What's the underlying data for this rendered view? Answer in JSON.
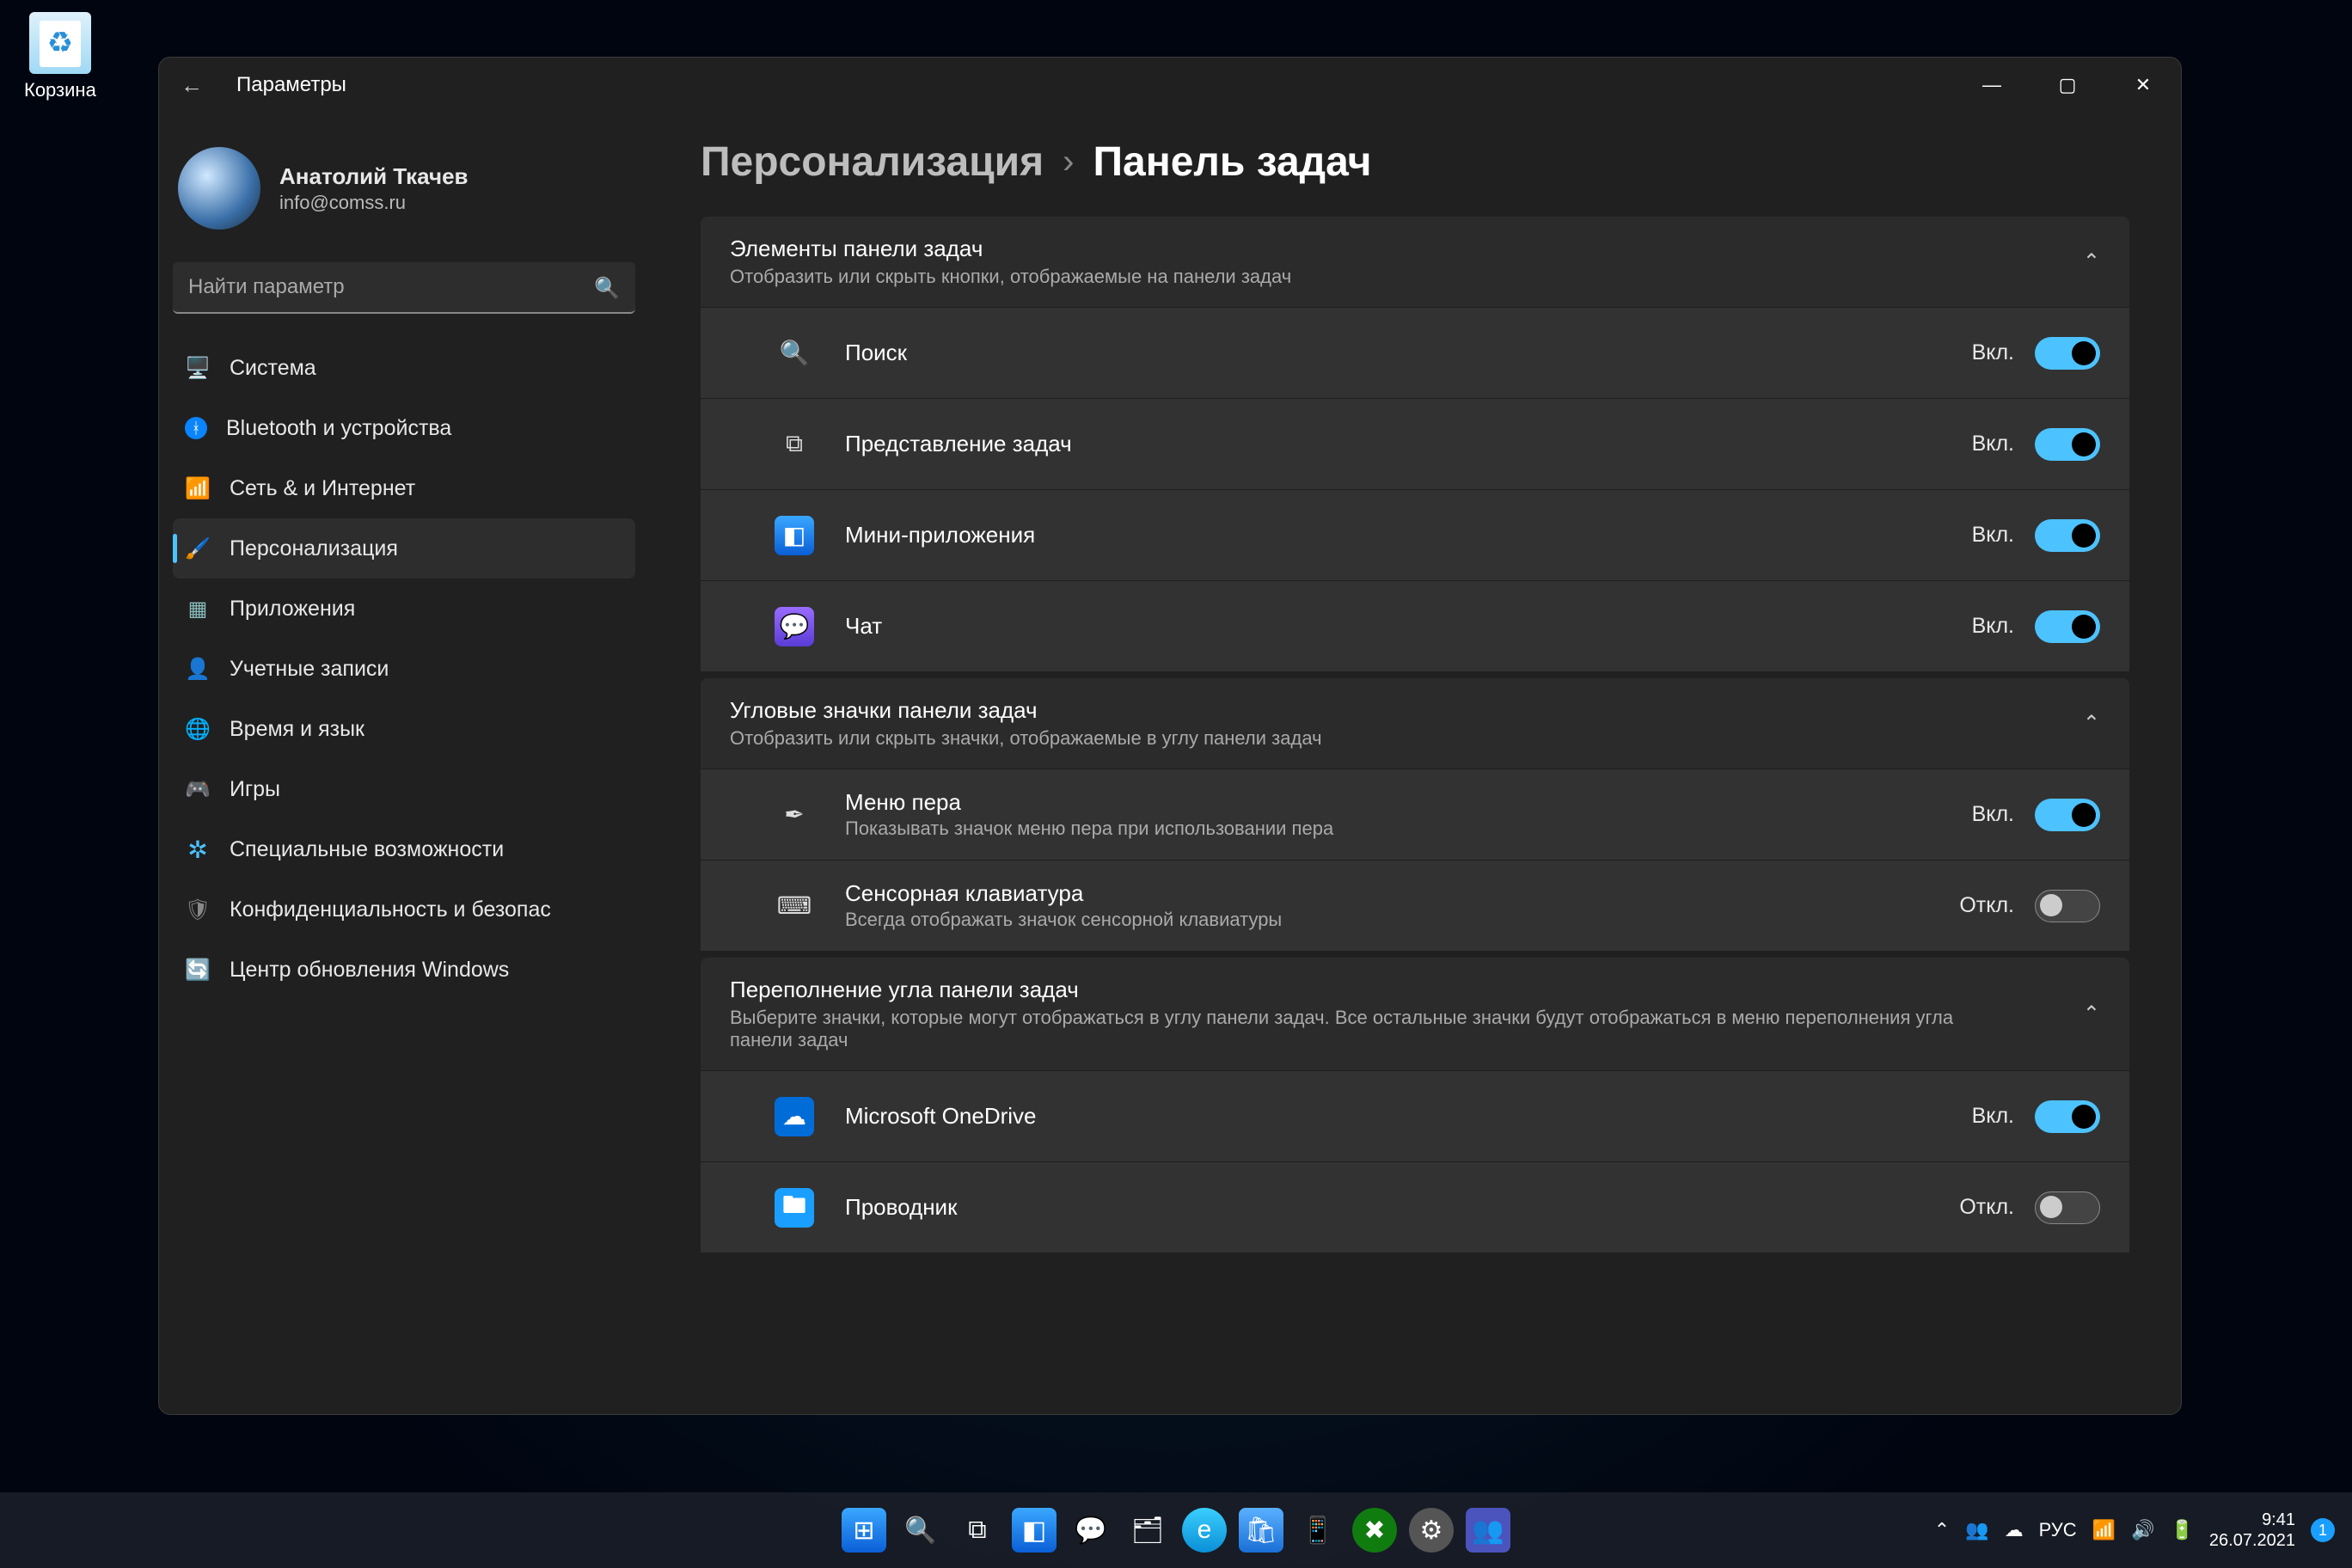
{
  "desktop": {
    "recycle_label": "Корзина"
  },
  "window": {
    "title": "Параметры",
    "min_icon": "—",
    "max_icon": "▢",
    "close_icon": "✕",
    "back_icon": "←"
  },
  "profile": {
    "name": "Анатолий Ткачев",
    "email": "info@comss.ru"
  },
  "search": {
    "placeholder": "Найти параметр",
    "icon": "🔍"
  },
  "sidebar": {
    "items": [
      {
        "icon": "🖥️",
        "label": "Система"
      },
      {
        "icon": "ᚼ",
        "label": "Bluetooth и устройства",
        "icon_style": "color:#fff;background:#0a84ff;border-radius:50%;width:26px;height:26px;line-height:26px;font-size:18px;text-align:center;"
      },
      {
        "icon": "📶",
        "label": "Сеть & и Интернет",
        "icon_style": "color:#3aa7ff"
      },
      {
        "icon": "🖌️",
        "label": "Персонализация",
        "selected": true
      },
      {
        "icon": "▦",
        "label": "Приложения",
        "icon_style": "color:#8bb"
      },
      {
        "icon": "👤",
        "label": "Учетные записи",
        "icon_style": "color:#6fc28a"
      },
      {
        "icon": "🌐",
        "label": "Время и язык",
        "icon_style": "color:#5ab0ff"
      },
      {
        "icon": "🎮",
        "label": "Игры",
        "icon_style": "color:#888"
      },
      {
        "icon": "✲",
        "label": "Специальные возможности",
        "icon_style": "color:#4cc2ff;font-size:28px"
      },
      {
        "icon": "🛡",
        "label": "Конфиденциальность и безопас",
        "icon_style": "color:#888"
      },
      {
        "icon": "🔄",
        "label": "Центр обновления Windows",
        "icon_style": "color:#1a9fff"
      }
    ]
  },
  "breadcrumb": {
    "parent": "Персонализация",
    "sep": "›",
    "current": "Панель задач"
  },
  "sections": {
    "items": {
      "title": "Элементы панели задач",
      "subtitle": "Отобразить или скрыть кнопки, отображаемые на панели задач",
      "chev": "⌃",
      "rows": [
        {
          "icon": "🔍",
          "label": "Поиск",
          "state": "Вкл.",
          "on": true
        },
        {
          "icon": "⧉",
          "label": "Представление задач",
          "state": "Вкл.",
          "on": true,
          "icon_class": ""
        },
        {
          "icon": "◧",
          "label": "Мини-приложения",
          "state": "Вкл.",
          "on": true,
          "icon_class": "widgets-ico"
        },
        {
          "icon": "💬",
          "label": "Чат",
          "state": "Вкл.",
          "on": true,
          "icon_class": "chat-ico"
        }
      ]
    },
    "corner": {
      "title": "Угловые значки панели задач",
      "subtitle": "Отобразить или скрыть значки, отображаемые в углу панели задач",
      "chev": "⌃",
      "rows": [
        {
          "icon": "✒",
          "label": "Меню пера",
          "sub": "Показывать значок меню пера при использовании пера",
          "state": "Вкл.",
          "on": true
        },
        {
          "icon": "⌨",
          "label": "Сенсорная клавиатура",
          "sub": "Всегда отображать значок сенсорной клавиатуры",
          "state": "Откл.",
          "on": false
        }
      ]
    },
    "overflow": {
      "title": "Переполнение угла панели задач",
      "subtitle": "Выберите значки, которые могут отображаться в углу панели задач. Все остальные значки будут отображаться в меню переполнения угла панели задач",
      "chev": "⌃",
      "rows": [
        {
          "icon": "☁",
          "label": "Microsoft OneDrive",
          "state": "Вкл.",
          "on": true,
          "icon_class": "onedrive-ico"
        },
        {
          "icon": "🖿",
          "label": "Проводник",
          "state": "Откл.",
          "on": false,
          "icon_class": "explorer-ico"
        }
      ]
    }
  },
  "states": {
    "on": "Вкл.",
    "off": "Откл."
  },
  "taskbar": {
    "center": [
      {
        "name": "start-icon",
        "glyph": "⊞",
        "class": "win"
      },
      {
        "name": "search-icon",
        "glyph": "🔍"
      },
      {
        "name": "taskview-icon",
        "glyph": "⧉"
      },
      {
        "name": "widgets-icon",
        "glyph": "◧",
        "class": "win"
      },
      {
        "name": "chat-icon",
        "glyph": "💬"
      },
      {
        "name": "explorer-icon",
        "glyph": "🗂"
      },
      {
        "name": "edge-icon",
        "glyph": "e",
        "class": "edge"
      },
      {
        "name": "store-icon",
        "glyph": "🛍",
        "class": "store"
      },
      {
        "name": "phone-icon",
        "glyph": "📱"
      },
      {
        "name": "xbox-icon",
        "glyph": "✖",
        "class": "xbox"
      },
      {
        "name": "settings-icon",
        "glyph": "⚙",
        "class": "settings"
      },
      {
        "name": "teams-icon",
        "glyph": "👥",
        "class": "teams"
      }
    ],
    "right": {
      "chevup": "⌃",
      "teams": "👥",
      "onedrive": "☁",
      "lang": "РУС",
      "wifi": "📶",
      "sound": "🔊",
      "battery": "🔋",
      "time": "9:41",
      "date": "26.07.2021",
      "badge": "1"
    }
  }
}
